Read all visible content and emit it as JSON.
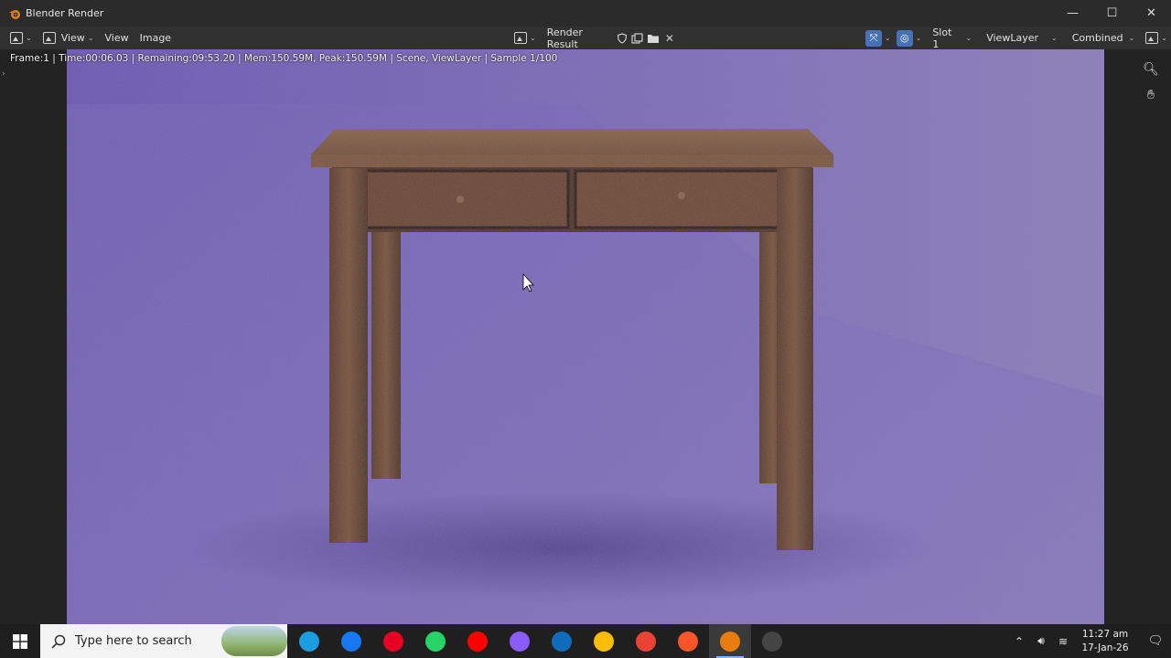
{
  "window": {
    "title": "Blender Render",
    "minimize": "—",
    "maximize": "☐",
    "close": "✕"
  },
  "header": {
    "view_dropdown": "View",
    "view_menu": "View",
    "image_menu": "Image",
    "image_name": "Render Result",
    "slot": "Slot 1",
    "view_layer": "ViewLayer",
    "pass": "Combined"
  },
  "stats": {
    "text": "Frame:1 | Time:00:06.03 | Remaining:09:53.20 | Mem:150.59M, Peak:150.59M | Scene, ViewLayer | Sample 1/100"
  },
  "taskbar": {
    "search_placeholder": "Type here to search",
    "time": "11:27 am",
    "date": "17-Jan-26",
    "apps": [
      {
        "name": "edge-icon",
        "color": "#1b9de2"
      },
      {
        "name": "facebook-icon",
        "color": "#1877f2"
      },
      {
        "name": "pinterest-icon",
        "color": "#e60023"
      },
      {
        "name": "whatsapp-icon",
        "color": "#25d366"
      },
      {
        "name": "youtube-icon",
        "color": "#ff0000"
      },
      {
        "name": "copilot-icon",
        "color": "#8a5cf5"
      },
      {
        "name": "outlook-icon",
        "color": "#0f6cbd"
      },
      {
        "name": "chrome-icon",
        "color": "#fbbc04"
      },
      {
        "name": "chrome-profile-icon",
        "color": "#ea4335"
      },
      {
        "name": "brave-icon",
        "color": "#fb542b"
      },
      {
        "name": "blender-icon",
        "color": "#e87d0d"
      },
      {
        "name": "recorder-icon",
        "color": "#444444"
      }
    ]
  },
  "colors": {
    "accent": "#4772b3",
    "floor": "#6e5fb0",
    "wood": "#6b4528"
  }
}
